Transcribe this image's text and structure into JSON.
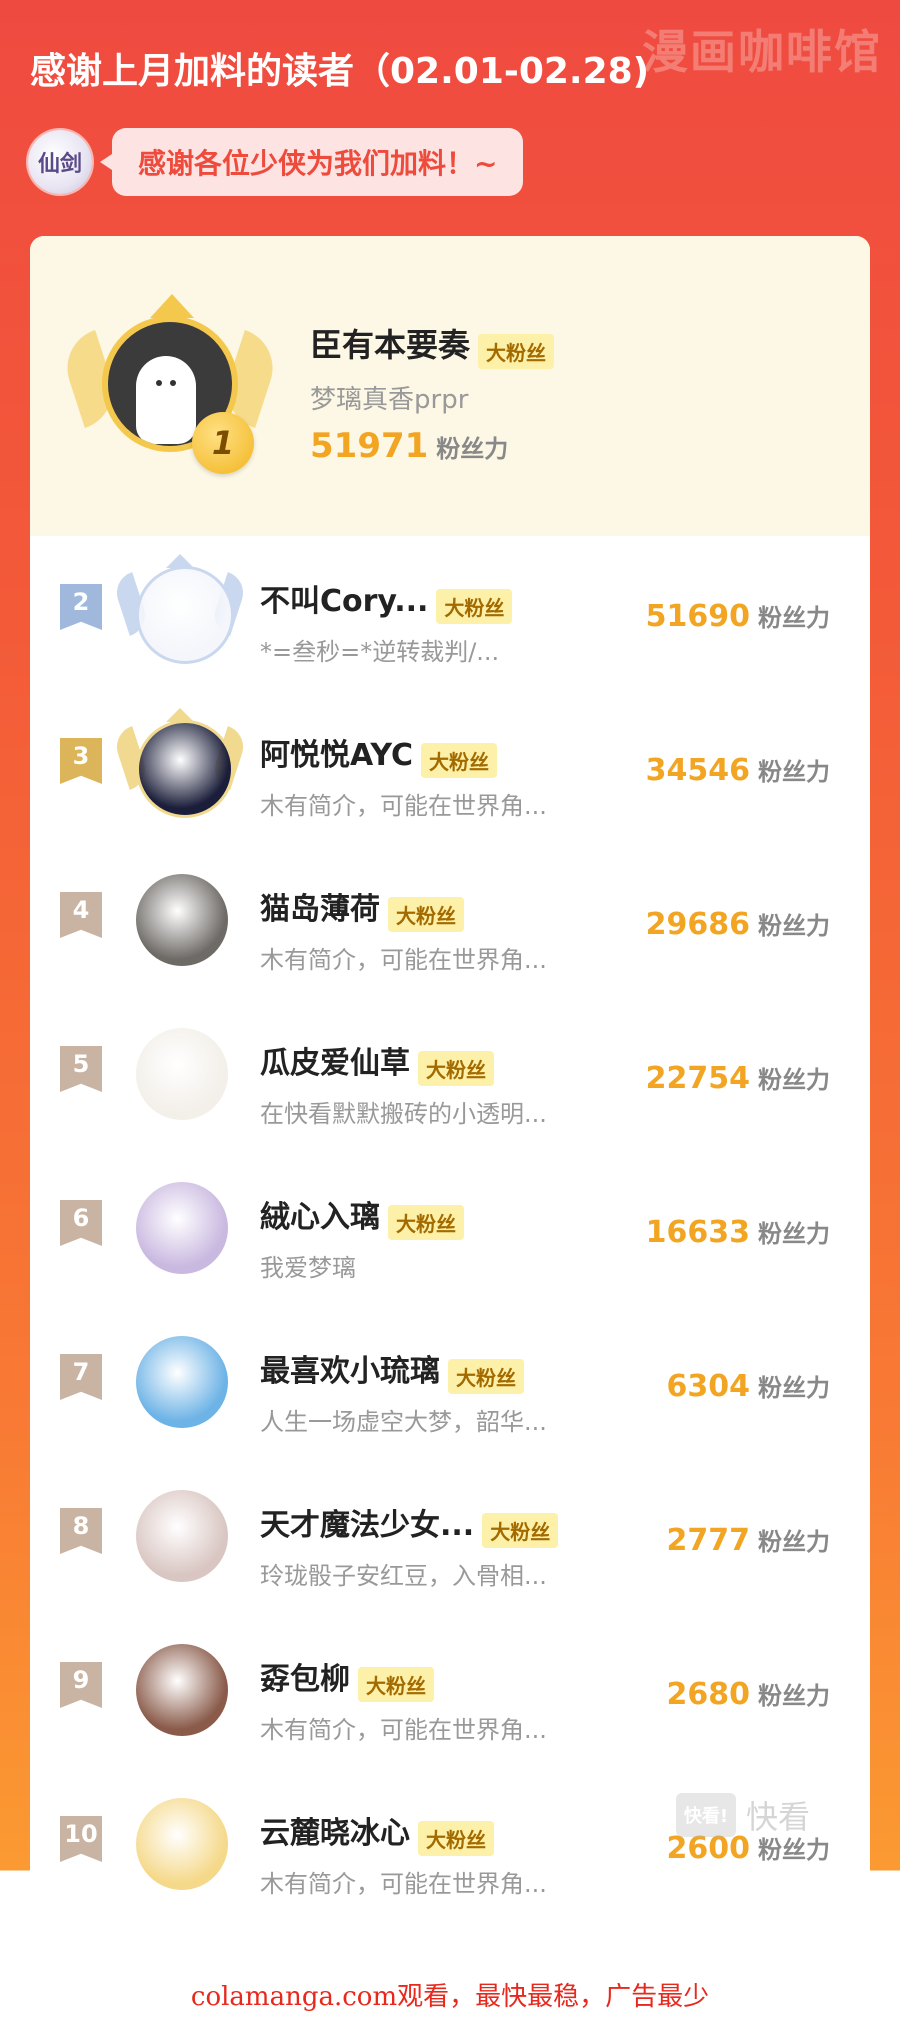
{
  "header": {
    "title": "感谢上月加料的读者（02.01-02.28)",
    "watermark": "漫画咖啡馆",
    "logo_text": "仙剑",
    "bubble_text": "感谢各位少侠为我们加料！~"
  },
  "top1": {
    "rank": "1",
    "name": "臣有本要奏",
    "badge": "大粉丝",
    "desc": "梦璃真香prpr",
    "score": "51971",
    "unit": "粉丝力"
  },
  "rows": [
    {
      "rank": "2",
      "name": "不叫Cory...",
      "badge": "大粉丝",
      "desc": "*=叁秒=*逆转裁判/...",
      "score": "51690",
      "unit": "粉丝力",
      "rank_color": "#9fb8dc",
      "frame_color": "#c9d8ef",
      "avatar_bg": "#f4f6fb"
    },
    {
      "rank": "3",
      "name": "阿悦悦AYC",
      "badge": "大粉丝",
      "desc": "木有简介，可能在世界角...",
      "score": "34546",
      "unit": "粉丝力",
      "rank_color": "#dcb45a",
      "frame_color": "#f1d98f",
      "avatar_bg": "#1b1e3a"
    },
    {
      "rank": "4",
      "name": "猫岛薄荷",
      "badge": "大粉丝",
      "desc": "木有简介，可能在世界角...",
      "score": "29686",
      "unit": "粉丝力",
      "rank_color": "#c9b4a4",
      "frame_color": "",
      "avatar_bg": "#6e6a66"
    },
    {
      "rank": "5",
      "name": "瓜皮爱仙草",
      "badge": "大粉丝",
      "desc": "在快看默默搬砖的小透明...",
      "score": "22754",
      "unit": "粉丝力",
      "rank_color": "#c9b4a4",
      "frame_color": "",
      "avatar_bg": "#f3efe9"
    },
    {
      "rank": "6",
      "name": "絨心入璃",
      "badge": "大粉丝",
      "desc": "我爱梦璃",
      "score": "16633",
      "unit": "粉丝力",
      "rank_color": "#c9b4a4",
      "frame_color": "",
      "avatar_bg": "#c9b8e0"
    },
    {
      "rank": "7",
      "name": "最喜欢小琉璃",
      "badge": "大粉丝",
      "desc": "人生一场虚空大梦，韶华...",
      "score": "6304",
      "unit": "粉丝力",
      "rank_color": "#c9b4a4",
      "frame_color": "",
      "avatar_bg": "#6db3e6"
    },
    {
      "rank": "8",
      "name": "天才魔法少女...",
      "badge": "大粉丝",
      "desc": "玲珑骰子安红豆，入骨相...",
      "score": "2777",
      "unit": "粉丝力",
      "rank_color": "#c9b4a4",
      "frame_color": "",
      "avatar_bg": "#d9c6c2"
    },
    {
      "rank": "9",
      "name": "孬包柳",
      "badge": "大粉丝",
      "desc": "木有简介，可能在世界角...",
      "score": "2680",
      "unit": "粉丝力",
      "rank_color": "#c9b4a4",
      "frame_color": "",
      "avatar_bg": "#8a5b4a"
    },
    {
      "rank": "10",
      "name": "云麓晓冰心",
      "badge": "大粉丝",
      "desc": "木有简介，可能在世界角...",
      "score": "2600",
      "unit": "粉丝力",
      "rank_color": "#c9b4a4",
      "frame_color": "",
      "avatar_bg": "#f5d98a"
    }
  ],
  "brand": {
    "box": "快看!",
    "text": "快看"
  },
  "footer": "colamanga.com观看，最快最稳，广告最少"
}
